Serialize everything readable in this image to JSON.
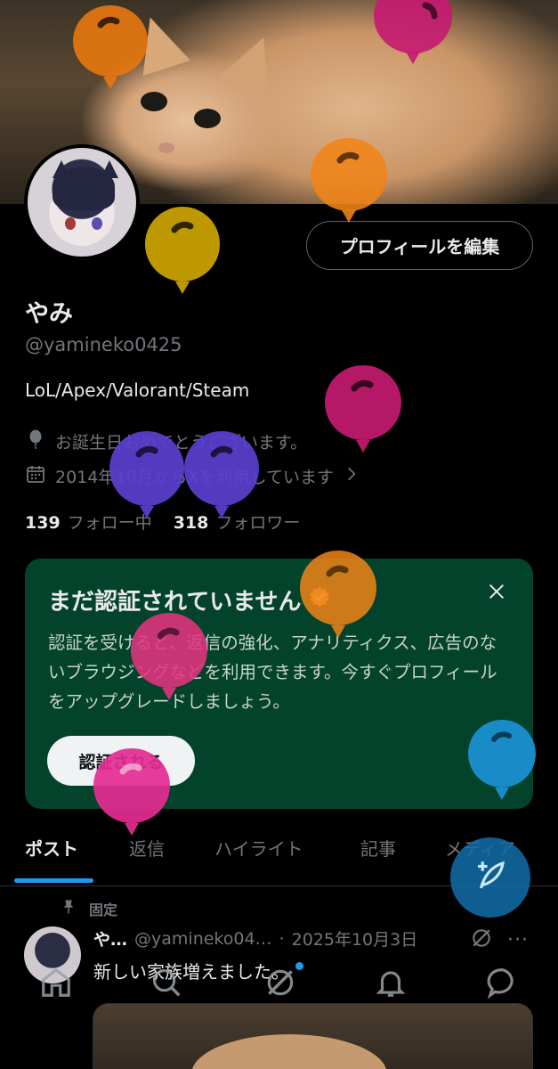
{
  "profile": {
    "edit_label": "プロフィールを編集",
    "name": "やみ",
    "handle": "@yamineko0425",
    "bio": "LoL/Apex/Valorant/Steam",
    "birthday_text": "お誕生日おめでとうございます。",
    "joined_text": "2014年10月からXを利用しています",
    "following_count": "139",
    "following_label": "フォロー中",
    "followers_count": "318",
    "followers_label": "フォロワー"
  },
  "verify_card": {
    "title": "まだ認証されていません",
    "body": "認証を受けると、返信の強化、アナリティクス、広告のないブラウジングなどを利用できます。今すぐプロフィールをアップグレードしましょう。",
    "button_label": "認証される"
  },
  "tabs": [
    {
      "label": "ポスト"
    },
    {
      "label": "返信"
    },
    {
      "label": "ハイライト"
    },
    {
      "label": "記事"
    },
    {
      "label": "メディア"
    }
  ],
  "post": {
    "pinned_label": "固定",
    "name": "や…",
    "handle": "@yamineko04…",
    "separator": "·",
    "date": "2025年10月3日",
    "more": "···",
    "text": "新しい家族増えました。"
  },
  "icons": {
    "compose": "compose-post-icon",
    "home": "home-icon",
    "search": "search-icon",
    "grok": "grok-icon",
    "notifications": "bell-icon",
    "messages": "message-icon"
  },
  "colors": {
    "accent": "#1d9bf0",
    "verify_card_bg": "#04432b",
    "verify_badge": "#f4aa3b"
  }
}
